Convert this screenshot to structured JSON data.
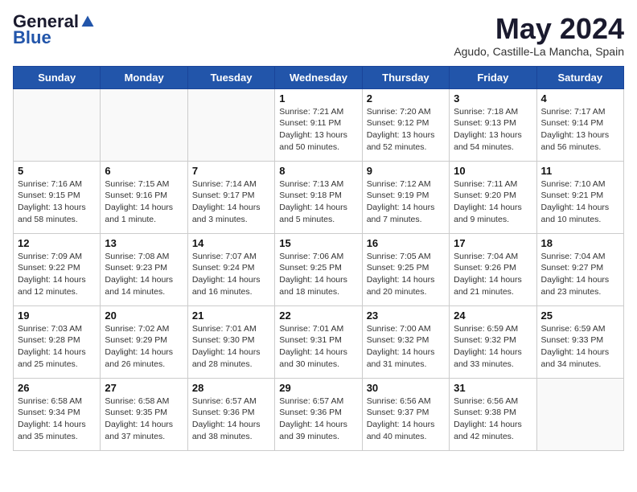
{
  "logo": {
    "general": "General",
    "blue": "Blue"
  },
  "header": {
    "month_year": "May 2024",
    "location": "Agudo, Castille-La Mancha, Spain"
  },
  "weekdays": [
    "Sunday",
    "Monday",
    "Tuesday",
    "Wednesday",
    "Thursday",
    "Friday",
    "Saturday"
  ],
  "weeks": [
    [
      {
        "day": "",
        "info": ""
      },
      {
        "day": "",
        "info": ""
      },
      {
        "day": "",
        "info": ""
      },
      {
        "day": "1",
        "info": "Sunrise: 7:21 AM\nSunset: 9:11 PM\nDaylight: 13 hours and 50 minutes."
      },
      {
        "day": "2",
        "info": "Sunrise: 7:20 AM\nSunset: 9:12 PM\nDaylight: 13 hours and 52 minutes."
      },
      {
        "day": "3",
        "info": "Sunrise: 7:18 AM\nSunset: 9:13 PM\nDaylight: 13 hours and 54 minutes."
      },
      {
        "day": "4",
        "info": "Sunrise: 7:17 AM\nSunset: 9:14 PM\nDaylight: 13 hours and 56 minutes."
      }
    ],
    [
      {
        "day": "5",
        "info": "Sunrise: 7:16 AM\nSunset: 9:15 PM\nDaylight: 13 hours and 58 minutes."
      },
      {
        "day": "6",
        "info": "Sunrise: 7:15 AM\nSunset: 9:16 PM\nDaylight: 14 hours and 1 minute."
      },
      {
        "day": "7",
        "info": "Sunrise: 7:14 AM\nSunset: 9:17 PM\nDaylight: 14 hours and 3 minutes."
      },
      {
        "day": "8",
        "info": "Sunrise: 7:13 AM\nSunset: 9:18 PM\nDaylight: 14 hours and 5 minutes."
      },
      {
        "day": "9",
        "info": "Sunrise: 7:12 AM\nSunset: 9:19 PM\nDaylight: 14 hours and 7 minutes."
      },
      {
        "day": "10",
        "info": "Sunrise: 7:11 AM\nSunset: 9:20 PM\nDaylight: 14 hours and 9 minutes."
      },
      {
        "day": "11",
        "info": "Sunrise: 7:10 AM\nSunset: 9:21 PM\nDaylight: 14 hours and 10 minutes."
      }
    ],
    [
      {
        "day": "12",
        "info": "Sunrise: 7:09 AM\nSunset: 9:22 PM\nDaylight: 14 hours and 12 minutes."
      },
      {
        "day": "13",
        "info": "Sunrise: 7:08 AM\nSunset: 9:23 PM\nDaylight: 14 hours and 14 minutes."
      },
      {
        "day": "14",
        "info": "Sunrise: 7:07 AM\nSunset: 9:24 PM\nDaylight: 14 hours and 16 minutes."
      },
      {
        "day": "15",
        "info": "Sunrise: 7:06 AM\nSunset: 9:25 PM\nDaylight: 14 hours and 18 minutes."
      },
      {
        "day": "16",
        "info": "Sunrise: 7:05 AM\nSunset: 9:25 PM\nDaylight: 14 hours and 20 minutes."
      },
      {
        "day": "17",
        "info": "Sunrise: 7:04 AM\nSunset: 9:26 PM\nDaylight: 14 hours and 21 minutes."
      },
      {
        "day": "18",
        "info": "Sunrise: 7:04 AM\nSunset: 9:27 PM\nDaylight: 14 hours and 23 minutes."
      }
    ],
    [
      {
        "day": "19",
        "info": "Sunrise: 7:03 AM\nSunset: 9:28 PM\nDaylight: 14 hours and 25 minutes."
      },
      {
        "day": "20",
        "info": "Sunrise: 7:02 AM\nSunset: 9:29 PM\nDaylight: 14 hours and 26 minutes."
      },
      {
        "day": "21",
        "info": "Sunrise: 7:01 AM\nSunset: 9:30 PM\nDaylight: 14 hours and 28 minutes."
      },
      {
        "day": "22",
        "info": "Sunrise: 7:01 AM\nSunset: 9:31 PM\nDaylight: 14 hours and 30 minutes."
      },
      {
        "day": "23",
        "info": "Sunrise: 7:00 AM\nSunset: 9:32 PM\nDaylight: 14 hours and 31 minutes."
      },
      {
        "day": "24",
        "info": "Sunrise: 6:59 AM\nSunset: 9:32 PM\nDaylight: 14 hours and 33 minutes."
      },
      {
        "day": "25",
        "info": "Sunrise: 6:59 AM\nSunset: 9:33 PM\nDaylight: 14 hours and 34 minutes."
      }
    ],
    [
      {
        "day": "26",
        "info": "Sunrise: 6:58 AM\nSunset: 9:34 PM\nDaylight: 14 hours and 35 minutes."
      },
      {
        "day": "27",
        "info": "Sunrise: 6:58 AM\nSunset: 9:35 PM\nDaylight: 14 hours and 37 minutes."
      },
      {
        "day": "28",
        "info": "Sunrise: 6:57 AM\nSunset: 9:36 PM\nDaylight: 14 hours and 38 minutes."
      },
      {
        "day": "29",
        "info": "Sunrise: 6:57 AM\nSunset: 9:36 PM\nDaylight: 14 hours and 39 minutes."
      },
      {
        "day": "30",
        "info": "Sunrise: 6:56 AM\nSunset: 9:37 PM\nDaylight: 14 hours and 40 minutes."
      },
      {
        "day": "31",
        "info": "Sunrise: 6:56 AM\nSunset: 9:38 PM\nDaylight: 14 hours and 42 minutes."
      },
      {
        "day": "",
        "info": ""
      }
    ]
  ]
}
